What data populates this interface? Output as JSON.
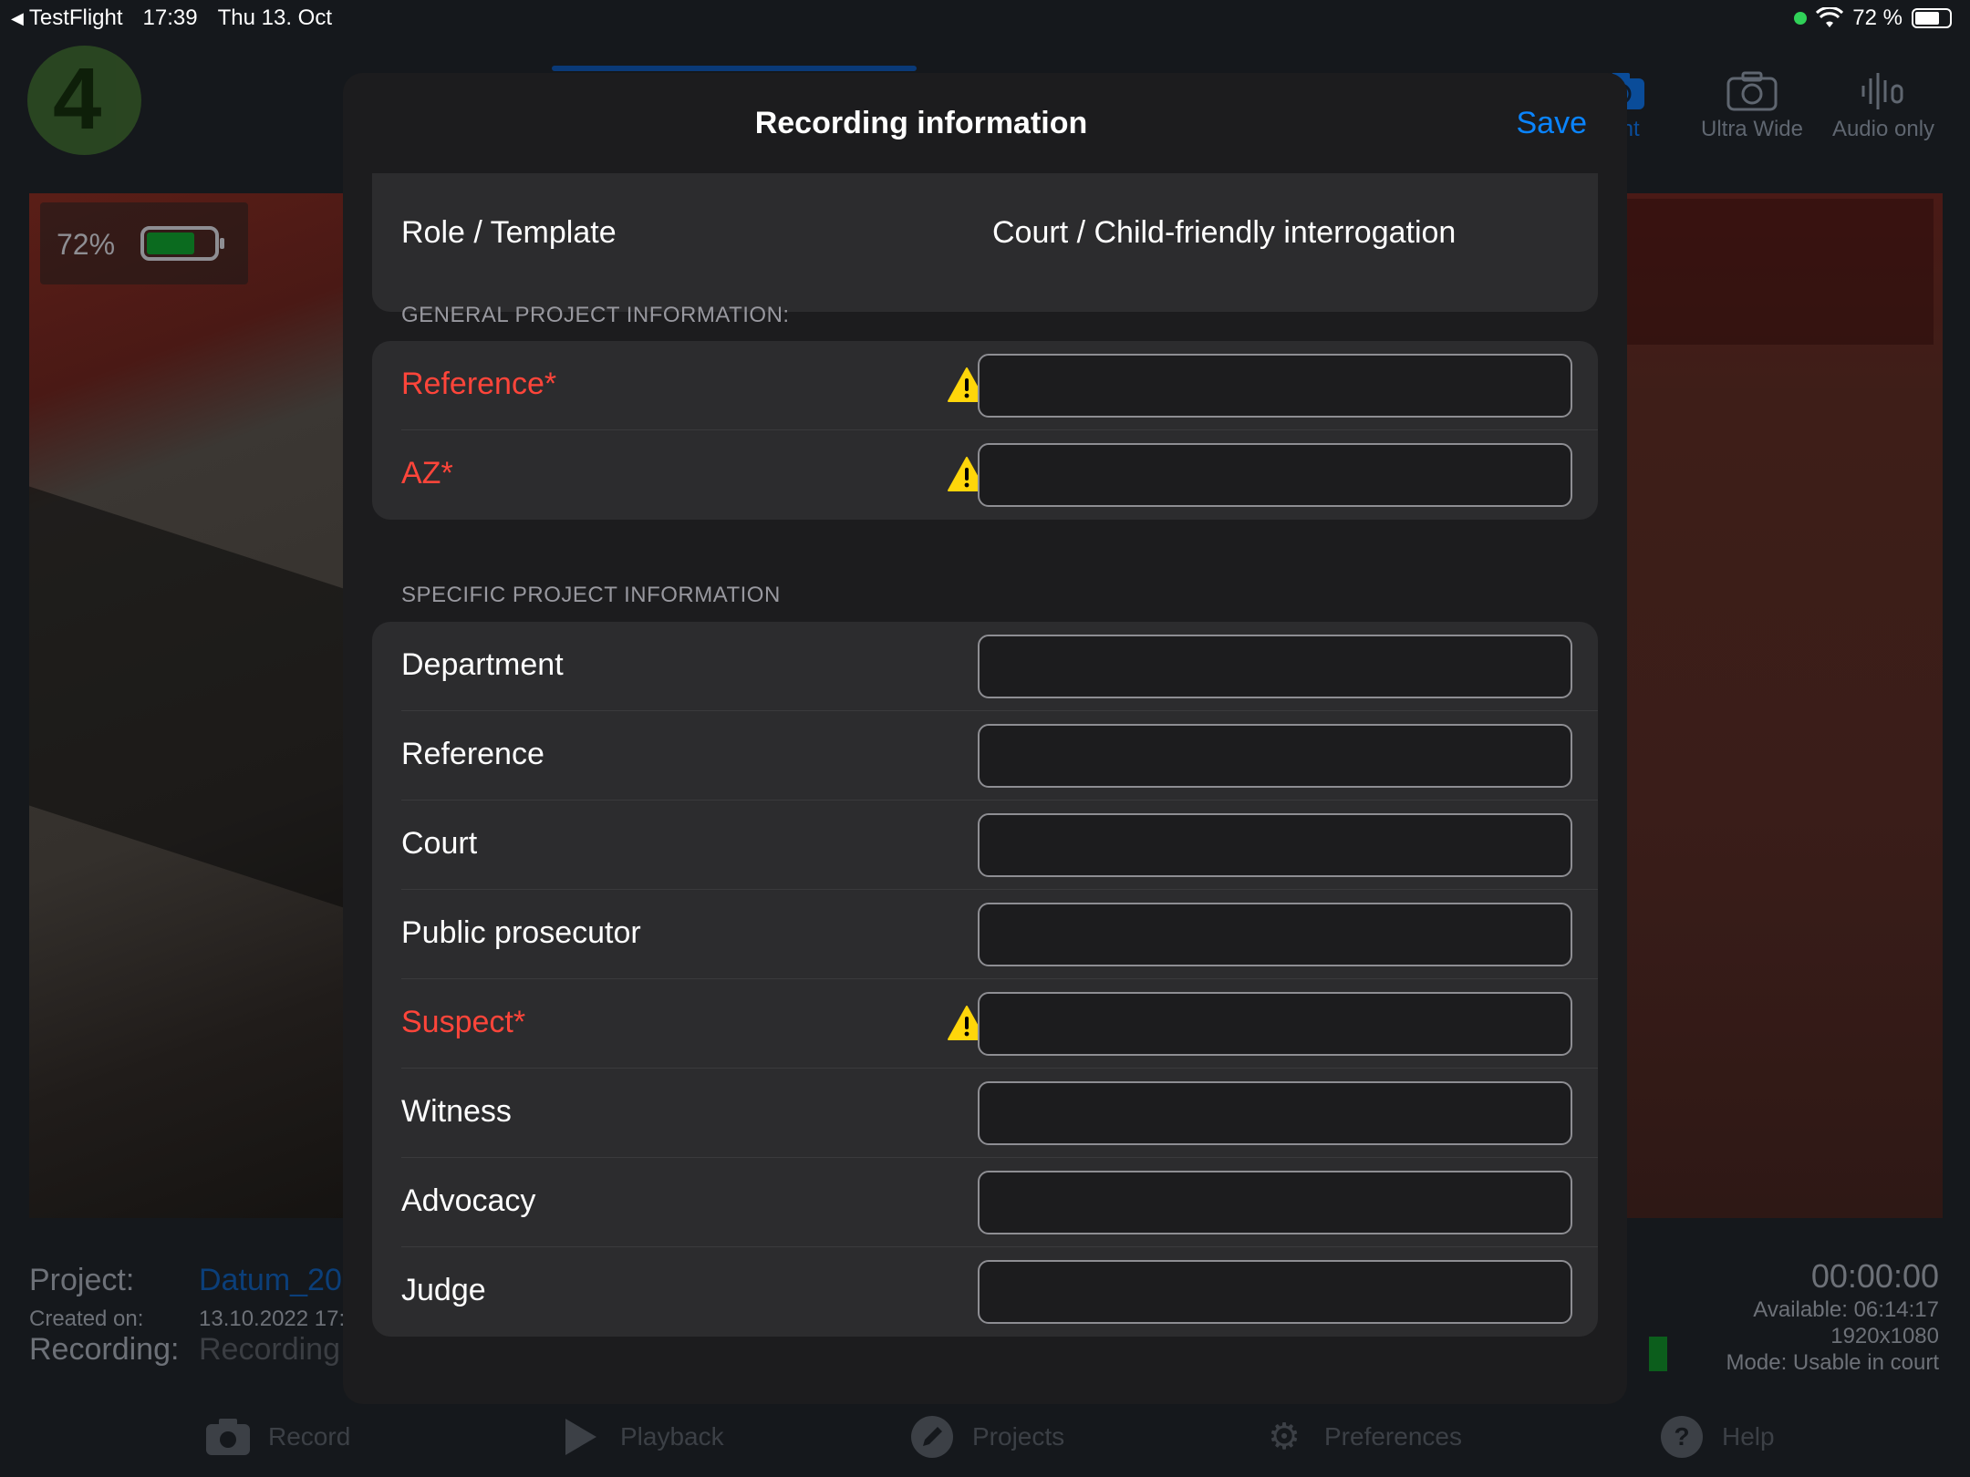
{
  "status_bar": {
    "back_app": "TestFlight",
    "time": "17:39",
    "date": "Thu 13. Oct",
    "battery_text": "72 %",
    "battery_level": 0.72
  },
  "camera_modes": [
    {
      "label": "ront",
      "icon": "camera-rotate-icon",
      "active": true
    },
    {
      "label": "Ultra Wide",
      "icon": "camera-rotate-icon",
      "active": false
    },
    {
      "label": "Audio only",
      "icon": "microphone-waveform-icon",
      "active": false
    }
  ],
  "preview": {
    "battery_pct": "72%",
    "battery_level": 0.72
  },
  "project_info": {
    "project_label": "Project:",
    "project_value": "Datum_20",
    "created_label": "Created on:",
    "created_value": "13.10.2022 17:",
    "recording_label": "Recording:",
    "recording_value": "Recording"
  },
  "recording_status": {
    "timer": "00:00:00",
    "available": "Available: 06:14:17",
    "resolution": "1920x1080",
    "mode": "Mode: Usable in court"
  },
  "tab_bar": [
    {
      "label": "Record",
      "icon": "camera-icon"
    },
    {
      "label": "Playback",
      "icon": "play-icon"
    },
    {
      "label": "Projects",
      "icon": "pencil-icon"
    },
    {
      "label": "Preferences",
      "icon": "gear-icon"
    },
    {
      "label": "Help",
      "icon": "question-icon"
    }
  ],
  "modal": {
    "title": "Recording information",
    "save_label": "Save",
    "role_label": "Role / Template",
    "role_value": "Court / Child-friendly interrogation",
    "general_header": "GENERAL PROJECT INFORMATION:",
    "general_fields": [
      {
        "label": "Reference*",
        "required": true,
        "value": ""
      },
      {
        "label": "AZ*",
        "required": true,
        "value": ""
      }
    ],
    "specific_header": "SPECIFIC PROJECT INFORMATION",
    "specific_fields": [
      {
        "label": "Department",
        "required": false,
        "value": ""
      },
      {
        "label": "Reference",
        "required": false,
        "value": ""
      },
      {
        "label": "Court",
        "required": false,
        "value": ""
      },
      {
        "label": "Public prosecutor",
        "required": false,
        "value": ""
      },
      {
        "label": "Suspect*",
        "required": true,
        "value": ""
      },
      {
        "label": "Witness",
        "required": false,
        "value": ""
      },
      {
        "label": "Advocacy",
        "required": false,
        "value": ""
      },
      {
        "label": "Judge",
        "required": false,
        "value": ""
      }
    ]
  },
  "colors": {
    "accent": "#0a84ff",
    "required": "#ff453a",
    "warning": "#ffd60a",
    "modal_bg": "#1c1c1e",
    "group_bg": "#2c2c2e"
  }
}
